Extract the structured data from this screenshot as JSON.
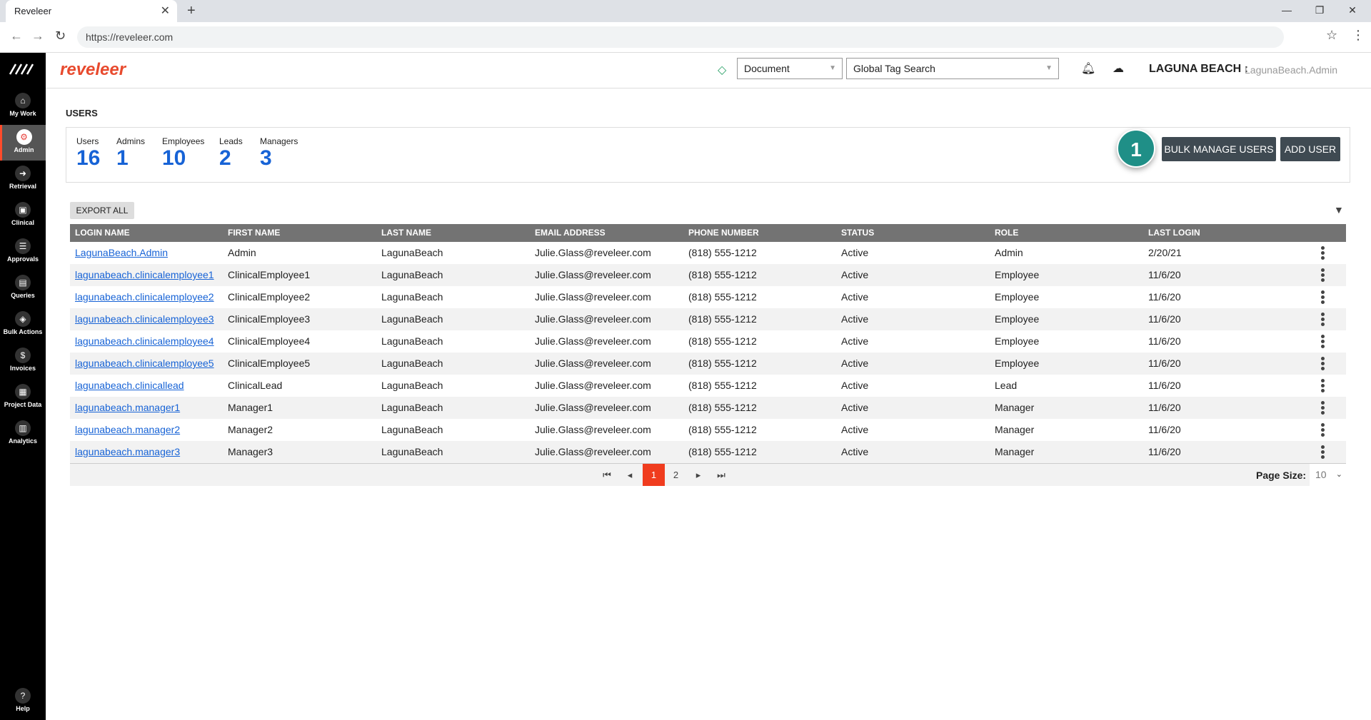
{
  "browser": {
    "tab_title": "Reveleer",
    "tab_close": "✕",
    "new_tab": "+",
    "url": "https://reveleer.com",
    "controls": {
      "minimize": "—",
      "restore": "❐",
      "close": "✕"
    }
  },
  "leftnav": {
    "items": [
      {
        "label": "My Work",
        "icon": "home-icon",
        "glyph": "⌂"
      },
      {
        "label": "Admin",
        "icon": "gear-icon",
        "glyph": "⚙"
      },
      {
        "label": "Retrieval",
        "icon": "arrow-right-icon",
        "glyph": "➜"
      },
      {
        "label": "Clinical",
        "icon": "clipboard-icon",
        "glyph": "▣"
      },
      {
        "label": "Approvals",
        "icon": "checklist-icon",
        "glyph": "☰"
      },
      {
        "label": "Queries",
        "icon": "chat-icon",
        "glyph": "▤"
      },
      {
        "label": "Bulk Actions",
        "icon": "layers-icon",
        "glyph": "◈"
      },
      {
        "label": "Invoices",
        "icon": "dollar-icon",
        "glyph": "$"
      },
      {
        "label": "Project Data",
        "icon": "grid-icon",
        "glyph": "▦"
      },
      {
        "label": "Analytics",
        "icon": "bar-chart-icon",
        "glyph": "▥"
      }
    ],
    "help": {
      "label": "Help",
      "glyph": "?"
    }
  },
  "header": {
    "brand": "reveleer",
    "doc_select": "Document",
    "tag_search": "Global Tag Search",
    "org": "LAGUNA BEACH :",
    "user": "LagunaBeach.Admin"
  },
  "page": {
    "title": "USERS",
    "stats": [
      {
        "label": "Users",
        "value": "16"
      },
      {
        "label": "Admins",
        "value": "1"
      },
      {
        "label": "Employees",
        "value": "10"
      },
      {
        "label": "Leads",
        "value": "2"
      },
      {
        "label": "Managers",
        "value": "3"
      }
    ],
    "callout": "1",
    "bulk_manage_label": "BULK MANAGE USERS",
    "add_user_label": "ADD USER",
    "export_label": "EXPORT ALL"
  },
  "table": {
    "columns": [
      "LOGIN NAME",
      "FIRST NAME",
      "LAST NAME",
      "EMAIL ADDRESS",
      "PHONE NUMBER",
      "STATUS",
      "ROLE",
      "LAST LOGIN"
    ],
    "rows": [
      [
        "LagunaBeach.Admin",
        "Admin",
        "LagunaBeach",
        "Julie.Glass@reveleer.com",
        "(818) 555-1212",
        "Active",
        "Admin",
        "2/20/21"
      ],
      [
        "lagunabeach.clinicalemployee1",
        "ClinicalEmployee1",
        "LagunaBeach",
        "Julie.Glass@reveleer.com",
        "(818) 555-1212",
        "Active",
        "Employee",
        "11/6/20"
      ],
      [
        "lagunabeach.clinicalemployee2",
        "ClinicalEmployee2",
        "LagunaBeach",
        "Julie.Glass@reveleer.com",
        "(818) 555-1212",
        "Active",
        "Employee",
        "11/6/20"
      ],
      [
        "lagunabeach.clinicalemployee3",
        "ClinicalEmployee3",
        "LagunaBeach",
        "Julie.Glass@reveleer.com",
        "(818) 555-1212",
        "Active",
        "Employee",
        "11/6/20"
      ],
      [
        "lagunabeach.clinicalemployee4",
        "ClinicalEmployee4",
        "LagunaBeach",
        "Julie.Glass@reveleer.com",
        "(818) 555-1212",
        "Active",
        "Employee",
        "11/6/20"
      ],
      [
        "lagunabeach.clinicalemployee5",
        "ClinicalEmployee5",
        "LagunaBeach",
        "Julie.Glass@reveleer.com",
        "(818) 555-1212",
        "Active",
        "Employee",
        "11/6/20"
      ],
      [
        "lagunabeach.clinicallead",
        "ClinicalLead",
        "LagunaBeach",
        "Julie.Glass@reveleer.com",
        "(818) 555-1212",
        "Active",
        "Lead",
        "11/6/20"
      ],
      [
        "lagunabeach.manager1",
        "Manager1",
        "LagunaBeach",
        "Julie.Glass@reveleer.com",
        "(818) 555-1212",
        "Active",
        "Manager",
        "11/6/20"
      ],
      [
        "lagunabeach.manager2",
        "Manager2",
        "LagunaBeach",
        "Julie.Glass@reveleer.com",
        "(818) 555-1212",
        "Active",
        "Manager",
        "11/6/20"
      ],
      [
        "lagunabeach.manager3",
        "Manager3",
        "LagunaBeach",
        "Julie.Glass@reveleer.com",
        "(818) 555-1212",
        "Active",
        "Manager",
        "11/6/20"
      ]
    ]
  },
  "pager": {
    "first": "⏮",
    "prev": "◂",
    "next": "▸",
    "last": "⏭",
    "pages": [
      "1",
      "2"
    ],
    "current": "1",
    "page_size_label": "Page Size:",
    "page_size": "10"
  },
  "colors": {
    "accent": "#f03c1e",
    "link": "#1763d6",
    "callout": "#1f8f87",
    "button": "#3f4a52"
  }
}
